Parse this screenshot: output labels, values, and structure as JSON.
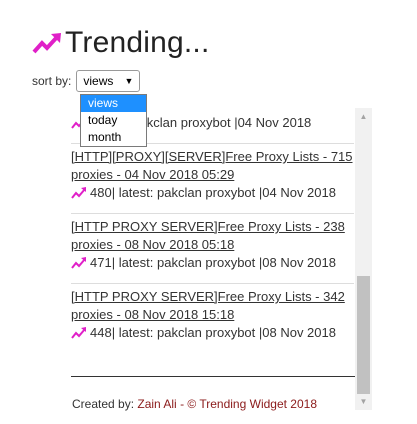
{
  "header": {
    "title": "Trending...",
    "icon": "trending-up-icon",
    "accent_color": "#e020c8"
  },
  "sort": {
    "label": "sort by:",
    "selected": "views",
    "options": [
      "views",
      "today",
      "month"
    ]
  },
  "items": [
    {
      "title": "",
      "meta": "latest: pakclan proxybot |04 Nov 2018"
    },
    {
      "title_line1": "[HTTP][PROXY][SERVER]Free Proxy Lists - 715",
      "title_line2": "proxies - 04 Nov 2018 05:29",
      "count": "480",
      "meta": "| latest: pakclan proxybot |04 Nov 2018"
    },
    {
      "title_line1": "[HTTP PROXY SERVER]Free Proxy Lists - 238",
      "title_line2": "proxies - 08 Nov 2018 05:18",
      "count": "471",
      "meta": "| latest: pakclan proxybot |08 Nov 2018"
    },
    {
      "title_line1": "[HTTP PROXY SERVER]Free Proxy Lists - 342",
      "title_line2": "proxies - 08 Nov 2018 15:18",
      "count": "448",
      "meta": "| latest: pakclan proxybot |08 Nov 2018"
    }
  ],
  "footer": {
    "prefix": "Created by: ",
    "author": "Zain Ali",
    "sep": " - ",
    "widget": "© Trending Widget 2018"
  }
}
